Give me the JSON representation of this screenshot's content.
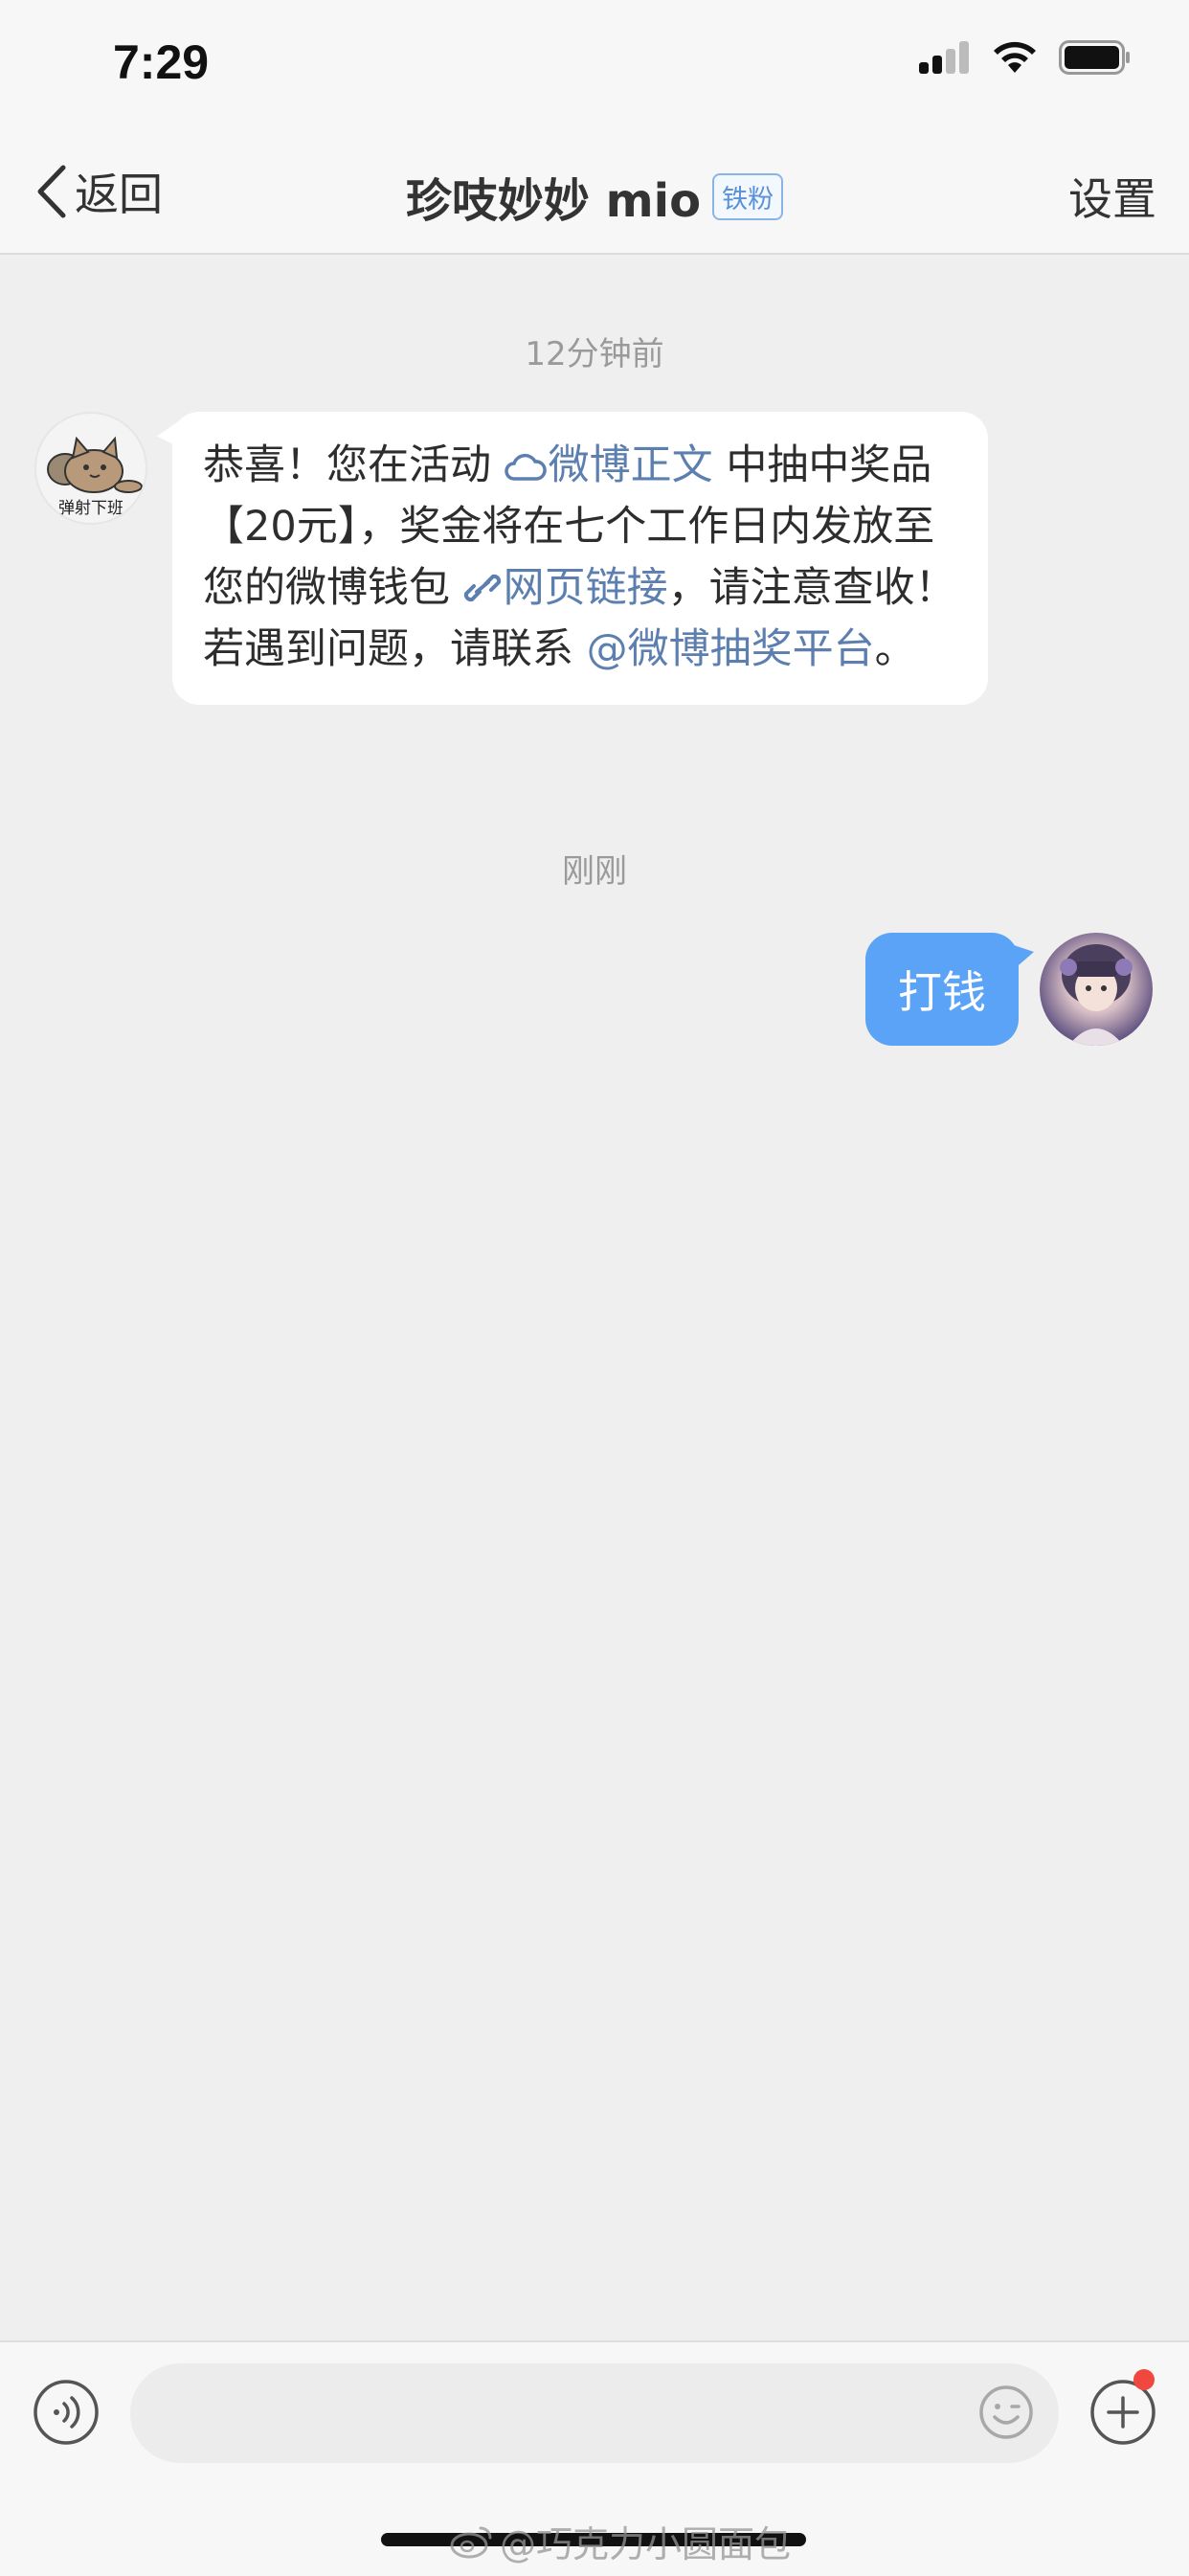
{
  "status_bar": {
    "time": "7:29"
  },
  "nav": {
    "back_label": "返回",
    "title": "珍吱妙妙 mio",
    "badge": "铁粉",
    "settings_label": "设置"
  },
  "messages": [
    {
      "timestamp": "12分钟前",
      "sender_avatar_text": "弹射下班",
      "parts": {
        "t1": "恭喜！您在活动 ",
        "link1": "微博正文",
        "t2": " 中抽中奖品【20元】，奖金将在七个工作日内发放至您的微博钱包 ",
        "link2": "网页链接",
        "t3": "，请注意查收！若遇到问题，请联系 ",
        "link3": "@微博抽奖平台",
        "t4": "。"
      }
    },
    {
      "timestamp": "刚刚",
      "text": "打钱"
    }
  ],
  "input_bar": {
    "placeholder": ""
  },
  "watermark": "@巧克力小圆面包",
  "colors": {
    "accent_blue": "#5aa3f7",
    "link_blue": "#5c7fb0",
    "badge_blue": "#5a91d8",
    "notify_red": "#f0483e"
  },
  "icons": [
    "signal-icon",
    "wifi-icon",
    "battery-icon",
    "back-chevron-icon",
    "weibo-cloud-icon",
    "link-chain-icon",
    "voice-icon",
    "emoji-icon",
    "plus-icon",
    "weibo-logo-icon"
  ]
}
